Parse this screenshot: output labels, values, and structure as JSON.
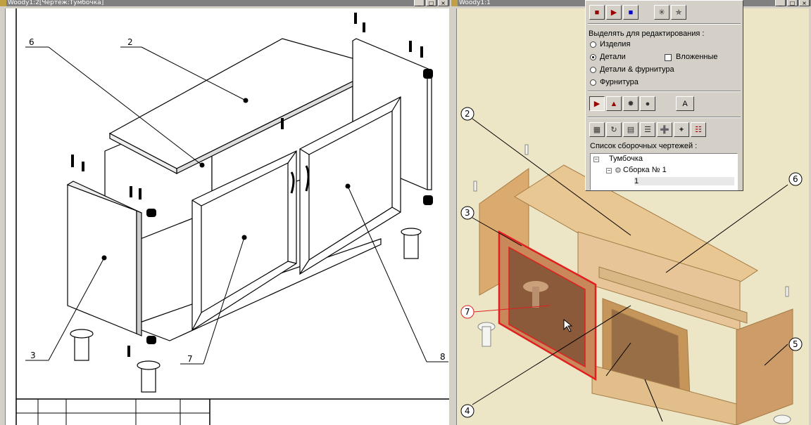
{
  "left_window": {
    "title": "Woody1:2[Чертеж:Тумбочка]",
    "callouts": [
      "6",
      "2",
      "3",
      "7",
      "8"
    ]
  },
  "right_window": {
    "title": "Woody1:1",
    "callouts": [
      "2",
      "3",
      "7",
      "4",
      "6",
      "5"
    ]
  },
  "window_buttons": {
    "minimize": "_",
    "maximize": "□",
    "close": "×"
  },
  "panel": {
    "select_label": "Выделять для редактирования :",
    "options": [
      "Изделия",
      "Детали",
      "Детали  & фурнитура",
      "Фурнитура"
    ],
    "selected_option": "Детали",
    "nested_label": "Вложенные",
    "nested_checked": false,
    "text_button": "A",
    "list_label": "Список сборочных чертежей :",
    "tree": {
      "root": "Тумбочка",
      "assembly": "Сборка № 1",
      "leaf": "1"
    }
  },
  "colors": {
    "selection": "#e02020",
    "wood_light": "#e8c28a",
    "wood_dark": "#b07838",
    "model_bg": "#ece6c6"
  }
}
